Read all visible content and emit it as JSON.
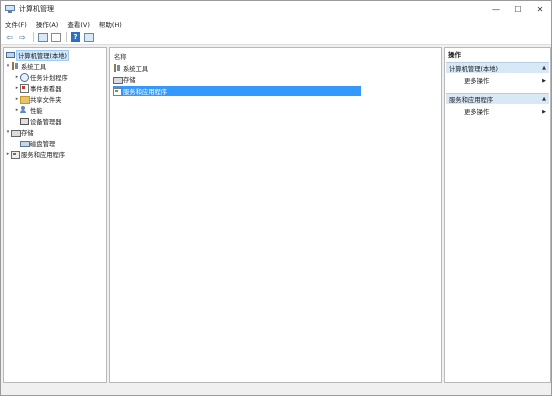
{
  "window": {
    "title": "计算机管理"
  },
  "window_controls": {
    "minimize": "—",
    "maximize": "☐",
    "close": "✕"
  },
  "menubar": {
    "items": [
      "文件(F)",
      "操作(A)",
      "查看(V)",
      "帮助(H)"
    ]
  },
  "toolbar": {
    "back": "⇦",
    "forward": "⇨",
    "help": "?"
  },
  "tree": {
    "root": "计算机管理(本地)",
    "system_tools": "系统工具",
    "task_scheduler": "任务计划程序",
    "event_viewer": "事件查看器",
    "shared_folders": "共享文件夹",
    "performance": "性能",
    "device_manager": "设备管理器",
    "storage": "存储",
    "disk_management": "磁盘管理",
    "services_apps": "服务和应用程序"
  },
  "center": {
    "column_header": "名称",
    "rows": [
      "系统工具",
      "存储",
      "服务和应用程序"
    ]
  },
  "actions": {
    "header": "操作",
    "section1": "计算机管理(本地)",
    "section1_more": "更多操作",
    "section2": "服务和应用程序",
    "section2_more": "更多操作"
  },
  "colors": {
    "selection": "#3399ff",
    "section_bg": "#d9e8f6"
  }
}
